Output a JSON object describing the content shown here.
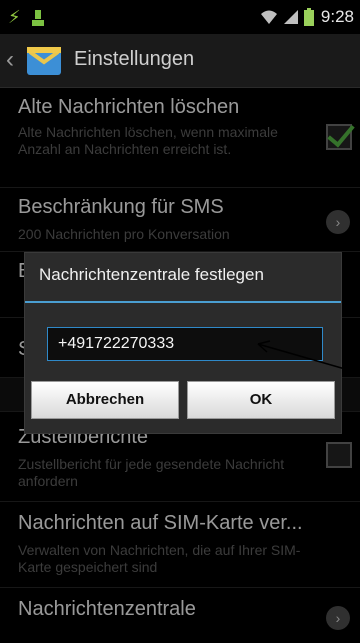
{
  "status": {
    "time": "9:28"
  },
  "actionbar": {
    "title": "Einstellungen"
  },
  "rows": [
    {
      "title": "Alte Nachrichten löschen",
      "sub": "Alte Nachrichten löschen, wenn maximale Anzahl an Nachrichten erreicht ist."
    },
    {
      "title": "Beschränkung für SMS",
      "sub": "200 Nachrichten pro Konversation"
    },
    {
      "title": "E"
    },
    {
      "title": "S"
    },
    {
      "title": "Zustellberichte",
      "sub": "Zustellbericht für jede gesendete Nachricht anfordern"
    },
    {
      "title": "Nachrichten auf SIM-Karte ver...",
      "sub": "Verwalten von Nachrichten, die auf Ihrer SIM-Karte gespeichert sind"
    },
    {
      "title": "Nachrichtenzentrale"
    }
  ],
  "dialog": {
    "title": "Nachrichtenzentrale festlegen",
    "input_value": "+491722270333",
    "cancel_label": "Abbrechen",
    "ok_label": "OK"
  },
  "colors": {
    "accent": "#4a9ed1",
    "check": "#52b043"
  }
}
